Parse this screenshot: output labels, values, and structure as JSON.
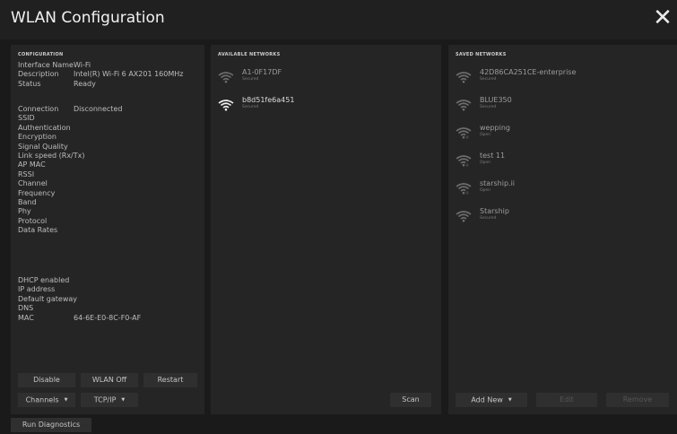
{
  "window": {
    "title": "WLAN Configuration",
    "close_icon": "close-icon"
  },
  "config": {
    "heading": "CONFIGURATION",
    "rows_a": [
      {
        "label": "Interface Name",
        "value": "Wi-Fi"
      },
      {
        "label": "Description",
        "value": "Intel(R) Wi-Fi 6 AX201 160MHz"
      },
      {
        "label": "Status",
        "value": "Ready"
      }
    ],
    "rows_b": [
      {
        "label": "Connection",
        "value": "Disconnected"
      },
      {
        "label": "SSID",
        "value": ""
      },
      {
        "label": "Authentication",
        "value": ""
      },
      {
        "label": "Encryption",
        "value": ""
      },
      {
        "label": "Signal Quality",
        "value": ""
      },
      {
        "label": "Link speed (Rx/Tx)",
        "value": ""
      },
      {
        "label": "AP MAC",
        "value": ""
      },
      {
        "label": "RSSI",
        "value": ""
      },
      {
        "label": "Channel",
        "value": ""
      },
      {
        "label": "Frequency",
        "value": ""
      },
      {
        "label": "Band",
        "value": ""
      },
      {
        "label": "Phy",
        "value": ""
      },
      {
        "label": "Protocol",
        "value": ""
      },
      {
        "label": "Data Rates",
        "value": ""
      }
    ],
    "rows_c": [
      {
        "label": "DHCP enabled",
        "value": ""
      },
      {
        "label": "IP address",
        "value": ""
      },
      {
        "label": "Default gateway",
        "value": ""
      },
      {
        "label": "DNS",
        "value": ""
      },
      {
        "label": "MAC",
        "value": "64-6E-E0-8C-F0-AF"
      }
    ],
    "buttons": {
      "disable": "Disable",
      "wlan_off": "WLAN Off",
      "restart": "Restart",
      "channels": "Channels",
      "tcpip": "TCP/IP"
    }
  },
  "available": {
    "heading": "AVAILABLE NETWORKS",
    "networks": [
      {
        "name": "A1-0F17DF",
        "status": "Secured",
        "active": false
      },
      {
        "name": "b8d51fe6a451",
        "status": "Secured",
        "active": true
      }
    ],
    "scan_label": "Scan"
  },
  "saved": {
    "heading": "SAVED NETWORKS",
    "networks": [
      {
        "name": "42D86CA251CE-enterprise",
        "status": "Secured",
        "open": false
      },
      {
        "name": "BLUE350",
        "status": "Secured",
        "open": false
      },
      {
        "name": "wepping",
        "status": "Open",
        "open": true
      },
      {
        "name": "test 11",
        "status": "Open",
        "open": true
      },
      {
        "name": "starship.ii",
        "status": "Open",
        "open": true
      },
      {
        "name": "Starship",
        "status": "Secured",
        "open": false
      }
    ],
    "add_new_label": "Add New",
    "edit_label": "Edit",
    "remove_label": "Remove"
  },
  "footer": {
    "diagnostics_label": "Run Diagnostics"
  }
}
